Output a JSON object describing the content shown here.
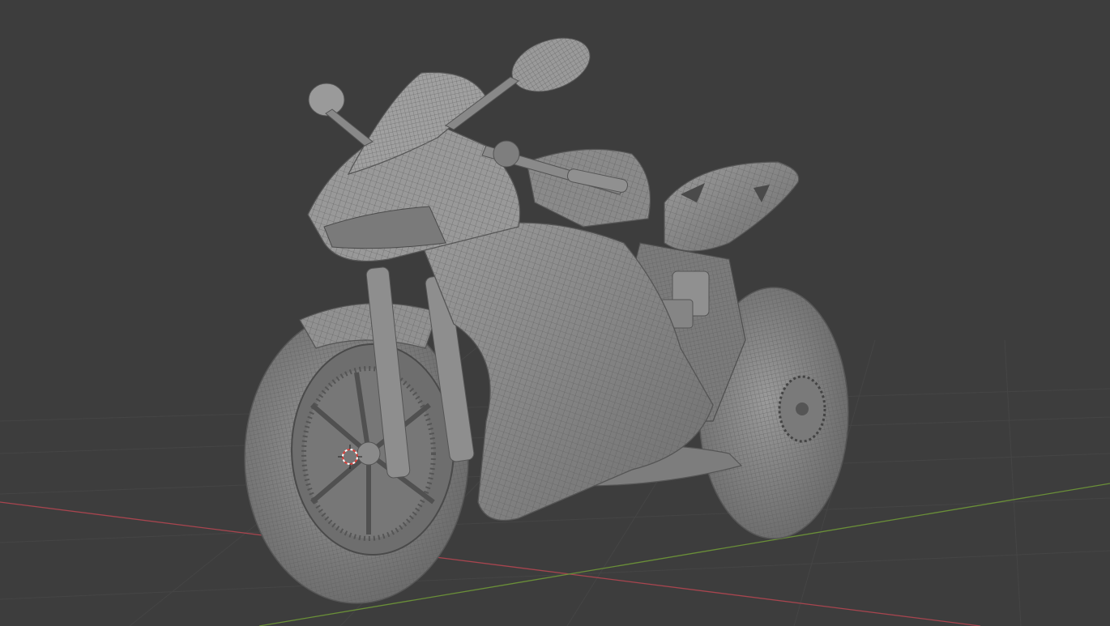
{
  "viewport": {
    "background": "#3d3d3d",
    "grid_color": "#4a4a4a",
    "x_axis_color": "#a8454f",
    "y_axis_color": "#6a8f38",
    "cursor_color": "#d9423c",
    "model_color": "#8c8c8c",
    "model_edge_color": "#5a5a5a"
  },
  "scene": {
    "object": "motorcycle-model",
    "shading": "solid-wireframe"
  }
}
